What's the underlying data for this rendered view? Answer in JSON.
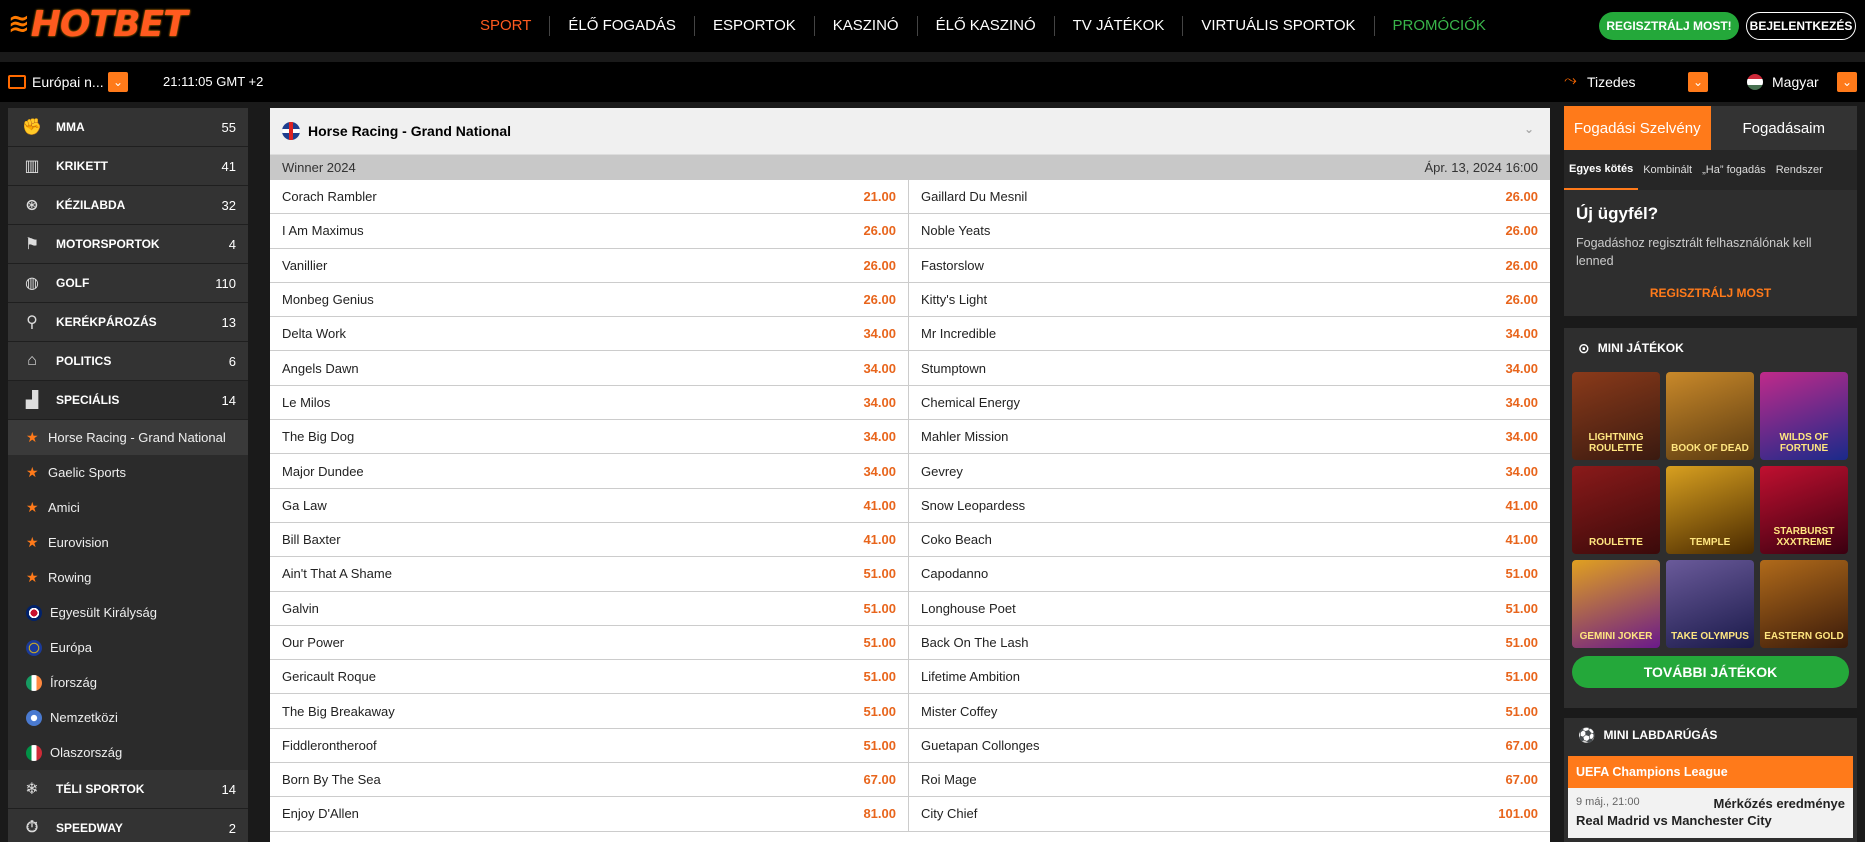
{
  "header": {
    "logo_text": "HOTBET",
    "nav": [
      "SPORT",
      "ÉLŐ FOGADÁS",
      "ESPORTOK",
      "KASZINÓ",
      "ÉLŐ KASZINÓ",
      "TV JÁTÉKOK",
      "VIRTUÁLIS SPORTOK",
      "PROMÓCIÓK"
    ],
    "register_label": "REGISZTRÁLJ MOST!",
    "login_label": "BEJELENTKEZÉS"
  },
  "subbar": {
    "timezone": "Európai n...",
    "clock": "21:11:05 GMT +2",
    "odds_format": "Tizedes",
    "language": "Magyar"
  },
  "sidebar": {
    "sports": [
      {
        "icon": "glove-icon",
        "label": "MMA",
        "count": "55"
      },
      {
        "icon": "cricket-icon",
        "label": "KRIKETT",
        "count": "41"
      },
      {
        "icon": "handball-icon",
        "label": "KÉZILABDA",
        "count": "32"
      },
      {
        "icon": "checkered-flag-icon",
        "label": "MOTORSPORTOK",
        "count": "4"
      },
      {
        "icon": "golf-ball-icon",
        "label": "GOLF",
        "count": "110"
      },
      {
        "icon": "bicycle-icon",
        "label": "KERÉKPÁROZÁS",
        "count": "13"
      },
      {
        "icon": "government-icon",
        "label": "POLITICS",
        "count": "6"
      },
      {
        "icon": "podium-icon",
        "label": "SPECIÁLIS",
        "count": "14"
      }
    ],
    "specials": [
      {
        "label": "Horse Racing - Grand National",
        "type": "star"
      },
      {
        "label": "Gaelic Sports",
        "type": "star"
      },
      {
        "label": "Amici",
        "type": "star"
      },
      {
        "label": "Eurovision",
        "type": "star"
      },
      {
        "label": "Rowing",
        "type": "star"
      },
      {
        "label": "Egyesült Királyság",
        "type": "flag-uk"
      },
      {
        "label": "Európa",
        "type": "flag-eu"
      },
      {
        "label": "Írország",
        "type": "flag-ie"
      },
      {
        "label": "Nemzetközi",
        "type": "flag-world"
      },
      {
        "label": "Olaszország",
        "type": "flag-it"
      }
    ],
    "more_sports": [
      {
        "icon": "snowflake-icon",
        "label": "TÉLI SPORTOK",
        "count": "14"
      },
      {
        "icon": "speedway-icon",
        "label": "SPEEDWAY",
        "count": "2"
      }
    ]
  },
  "event": {
    "title": "Horse Racing - Grand National",
    "market": "Winner 2024",
    "date": "Ápr. 13, 2024 16:00",
    "selections": [
      [
        "Corach Rambler",
        "21.00",
        "Gaillard Du Mesnil",
        "26.00"
      ],
      [
        "I Am Maximus",
        "26.00",
        "Noble Yeats",
        "26.00"
      ],
      [
        "Vanillier",
        "26.00",
        "Fastorslow",
        "26.00"
      ],
      [
        "Monbeg Genius",
        "26.00",
        "Kitty's Light",
        "26.00"
      ],
      [
        "Delta Work",
        "34.00",
        "Mr Incredible",
        "34.00"
      ],
      [
        "Angels Dawn",
        "34.00",
        "Stumptown",
        "34.00"
      ],
      [
        "Le Milos",
        "34.00",
        "Chemical Energy",
        "34.00"
      ],
      [
        "The Big Dog",
        "34.00",
        "Mahler Mission",
        "34.00"
      ],
      [
        "Major Dundee",
        "34.00",
        "Gevrey",
        "34.00"
      ],
      [
        "Ga Law",
        "41.00",
        "Snow Leopardess",
        "41.00"
      ],
      [
        "Bill Baxter",
        "41.00",
        "Coko Beach",
        "41.00"
      ],
      [
        "Ain't That A Shame",
        "51.00",
        "Capodanno",
        "51.00"
      ],
      [
        "Galvin",
        "51.00",
        "Longhouse Poet",
        "51.00"
      ],
      [
        "Our Power",
        "51.00",
        "Back On The Lash",
        "51.00"
      ],
      [
        "Gericault Roque",
        "51.00",
        "Lifetime Ambition",
        "51.00"
      ],
      [
        "The Big Breakaway",
        "51.00",
        "Mister Coffey",
        "51.00"
      ],
      [
        "Fiddlerontheroof",
        "51.00",
        "Guetapan Collonges",
        "67.00"
      ],
      [
        "Born By The Sea",
        "67.00",
        "Roi Mage",
        "67.00"
      ],
      [
        "Enjoy D'Allen",
        "81.00",
        "City Chief",
        "101.00"
      ]
    ]
  },
  "betslip": {
    "tabs": [
      "Fogadási Szelvény",
      "Fogadásaim"
    ],
    "types": [
      "Egyes kötés",
      "Kombinált",
      "„Ha” fogadás",
      "Rendszer"
    ],
    "title": "Új ügyfél?",
    "text": "Fogadáshoz regisztrált felhasználónak kell lenned",
    "link": "REGISZTRÁLJ MOST"
  },
  "mini_games": {
    "title": "MINI JÁTÉKOK",
    "games": [
      {
        "name": "LIGHTNING ROULETTE",
        "color1": "#3a1a10",
        "color2": "#8a3a1a"
      },
      {
        "name": "BOOK OF DEAD",
        "color1": "#5a3a10",
        "color2": "#c9892a"
      },
      {
        "name": "WILDS OF FORTUNE",
        "color1": "#1a2a8a",
        "color2": "#c02a8a"
      },
      {
        "name": "ROULETTE",
        "color1": "#3a0a0a",
        "color2": "#8a1a1a"
      },
      {
        "name": "TEMPLE",
        "color1": "#4a2a00",
        "color2": "#d8a020"
      },
      {
        "name": "STARBURST XXXTREME",
        "color1": "#3a0010",
        "color2": "#c01030"
      },
      {
        "name": "GEMINI JOKER",
        "color1": "#6a1a8a",
        "color2": "#e0a020"
      },
      {
        "name": "TAKE OLYMPUS",
        "color1": "#1a1a4a",
        "color2": "#6a5a9a"
      },
      {
        "name": "EASTERN GOLD",
        "color1": "#3a1a0a",
        "color2": "#b06a1a"
      }
    ],
    "more_label": "TOVÁBBI JÁTÉKOK"
  },
  "mini_football": {
    "title": "MINI LABDARÚGÁS",
    "league": "UEFA Champions League",
    "time": "9 máj., 21:00",
    "market": "Mérkőzés eredménye",
    "teams": "Real Madrid vs Manchester City"
  },
  "colors": {
    "accent": "#ff7a1a",
    "green": "#24a83a",
    "odds": "#e8651c"
  }
}
